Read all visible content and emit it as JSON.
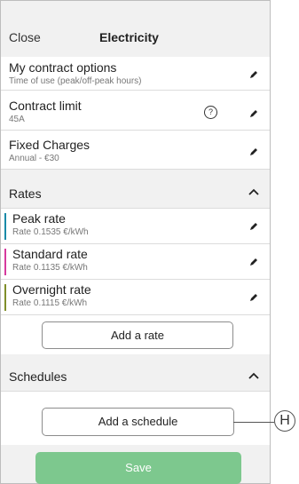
{
  "header": {
    "close_label": "Close",
    "title": "Electricity"
  },
  "rows": [
    {
      "title": "My contract options",
      "subtitle": "Time of use (peak/off-peak hours)"
    },
    {
      "title": "Contract limit",
      "subtitle": "45A"
    },
    {
      "title": "Fixed Charges",
      "subtitle": "Annual - €30"
    }
  ],
  "help_label": "?",
  "rates_section": {
    "title": "Rates"
  },
  "rates": [
    {
      "title": "Peak rate",
      "subtitle": "Rate 0.1535 €/kWh",
      "color": "#1a8aa8"
    },
    {
      "title": "Standard rate",
      "subtitle": "Rate 0.1135 €/kWh",
      "color": "#d63a9e"
    },
    {
      "title": "Overnight rate",
      "subtitle": "Rate 0.1115 €/kWh",
      "color": "#7f8e2a"
    }
  ],
  "add_rate_label": "Add a rate",
  "schedules_section": {
    "title": "Schedules"
  },
  "add_schedule_label": "Add a schedule",
  "save_label": "Save",
  "callout_label": "H",
  "colors": {
    "save": "#7dc88e",
    "background": "#f1f1f1"
  }
}
